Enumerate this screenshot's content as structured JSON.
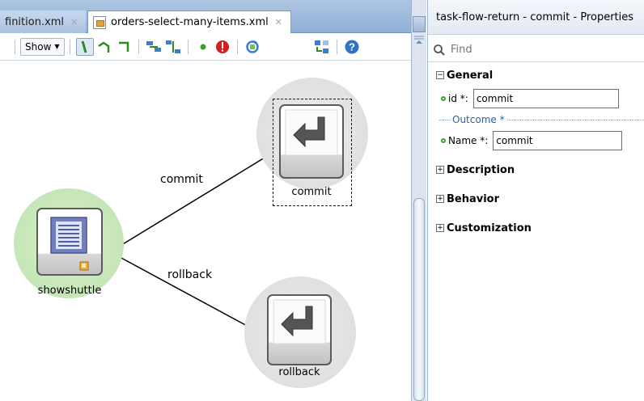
{
  "editor": {
    "tabs": [
      {
        "label": "finition.xml",
        "active": false
      },
      {
        "label": "orders-select-many-items.xml",
        "active": true
      }
    ],
    "toolbar": {
      "show_label": "Show",
      "icons": [
        "control-flow-icon",
        "wildcard-flow-icon",
        "return-flow-icon",
        "layout-horizontal-icon",
        "layout-vertical-icon",
        "default-activity-icon",
        "exception-handler-icon",
        "refresh-icon",
        "overview-icon",
        "help-icon"
      ]
    },
    "diagram": {
      "nodes": [
        {
          "id": "showshuttle",
          "label": "showshuttle",
          "type": "view",
          "halo": "green"
        },
        {
          "id": "commit",
          "label": "commit",
          "type": "task-flow-return",
          "selected": true
        },
        {
          "id": "rollback",
          "label": "rollback",
          "type": "task-flow-return"
        }
      ],
      "edges": [
        {
          "from": "showshuttle",
          "to": "commit",
          "label": "commit"
        },
        {
          "from": "showshuttle",
          "to": "rollback",
          "label": "rollback"
        }
      ]
    }
  },
  "properties": {
    "title": "task-flow-return - commit - Properties",
    "find_placeholder": "Find",
    "sections": {
      "general": {
        "label": "General",
        "expanded": true,
        "id_label": "id *:",
        "id_value": "commit",
        "outcome_label": "Outcome *",
        "name_label": "Name *:",
        "name_value": "commit"
      },
      "description": {
        "label": "Description",
        "expanded": false
      },
      "behavior": {
        "label": "Behavior",
        "expanded": false
      },
      "customization": {
        "label": "Customization",
        "expanded": false
      }
    },
    "expand_symbol": "+",
    "collapse_symbol": "−"
  },
  "colors": {
    "tab_bar": "#8fb0d6",
    "required_dot": "#41a132",
    "outcome_text": "#2f5f9c",
    "view_halo": "#c7e7b8",
    "return_halo": "#e2e2e2"
  }
}
